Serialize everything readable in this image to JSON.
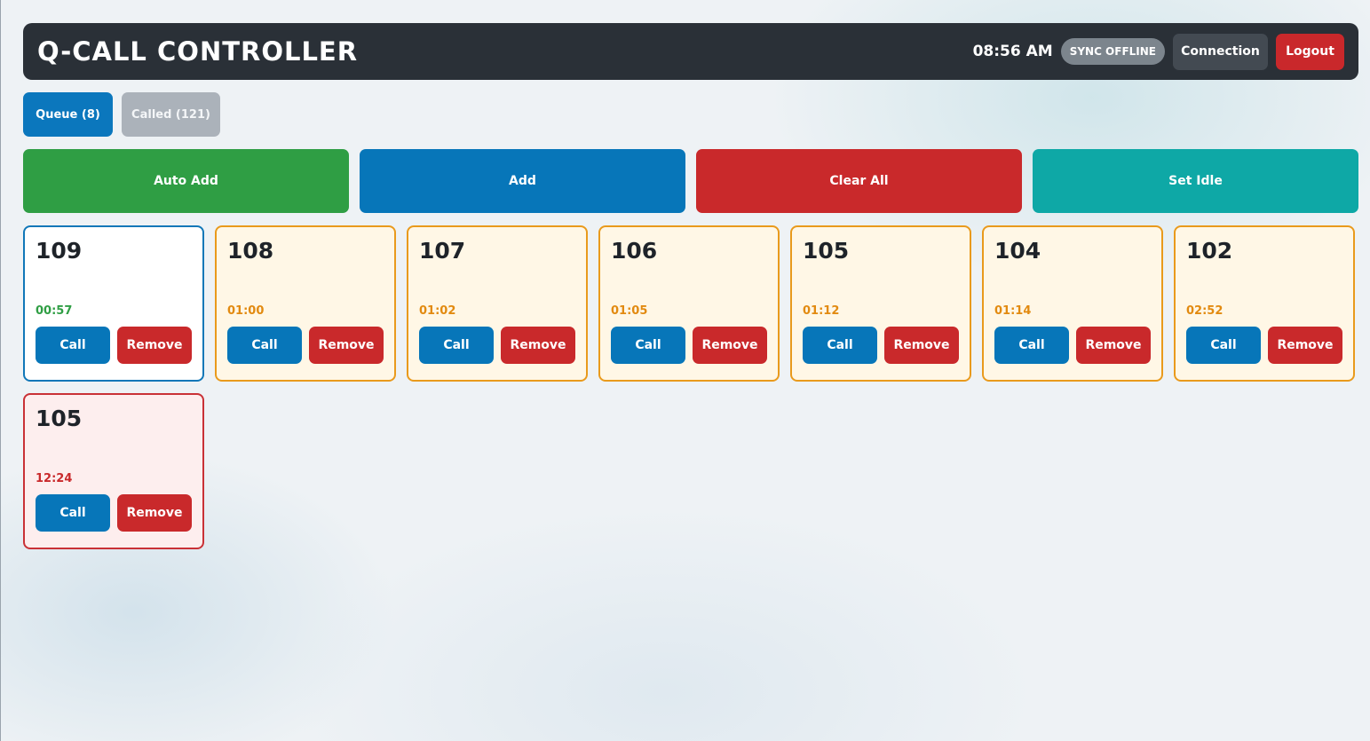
{
  "header": {
    "title": "Q-CALL CONTROLLER",
    "time": "08:56 AM",
    "sync_status": "SYNC OFFLINE",
    "connection_label": "Connection",
    "logout_label": "Logout"
  },
  "tabs": [
    {
      "label": "Queue (8)",
      "active": true
    },
    {
      "label": "Called (121)",
      "active": false
    }
  ],
  "actions": {
    "auto_add": "Auto Add",
    "add": "Add",
    "clear_all": "Clear All",
    "set_idle": "Set Idle"
  },
  "queue": [
    {
      "number": "109",
      "wait": "00:57",
      "state": "fresh",
      "call_label": "Call",
      "remove_label": "Remove"
    },
    {
      "number": "108",
      "wait": "01:00",
      "state": "waiting",
      "call_label": "Call",
      "remove_label": "Remove"
    },
    {
      "number": "107",
      "wait": "01:02",
      "state": "waiting",
      "call_label": "Call",
      "remove_label": "Remove"
    },
    {
      "number": "106",
      "wait": "01:05",
      "state": "waiting",
      "call_label": "Call",
      "remove_label": "Remove"
    },
    {
      "number": "105",
      "wait": "01:12",
      "state": "waiting",
      "call_label": "Call",
      "remove_label": "Remove"
    },
    {
      "number": "104",
      "wait": "01:14",
      "state": "waiting",
      "call_label": "Call",
      "remove_label": "Remove"
    },
    {
      "number": "102",
      "wait": "02:52",
      "state": "waiting",
      "call_label": "Call",
      "remove_label": "Remove"
    },
    {
      "number": "105",
      "wait": "12:24",
      "state": "late",
      "call_label": "Call",
      "remove_label": "Remove"
    }
  ],
  "colors": {
    "header_bg": "#2a3037",
    "primary": "#0776b9",
    "success": "#2f9e44",
    "danger": "#c9292b",
    "teal": "#0ea8a6",
    "waiting_border": "#e99a1c"
  }
}
